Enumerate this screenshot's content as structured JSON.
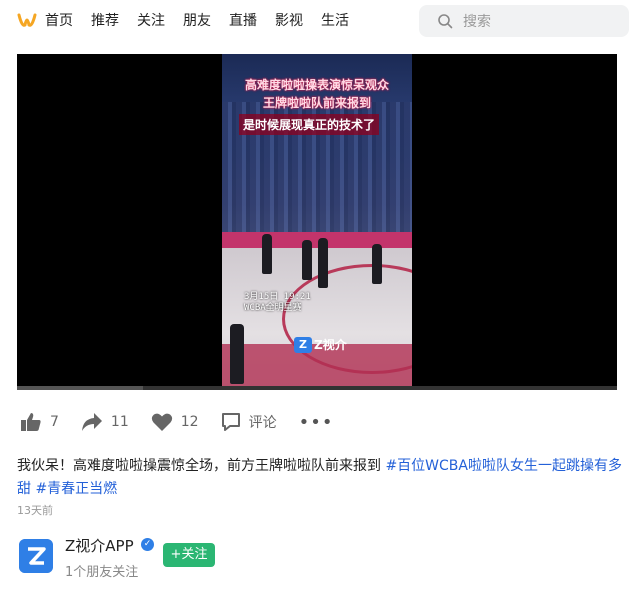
{
  "nav": {
    "items": [
      "首页",
      "推荐",
      "关注",
      "朋友",
      "直播",
      "影视",
      "生活"
    ],
    "search_placeholder": "搜索"
  },
  "video": {
    "overlay_title_1": "高难度啦啦操表演惊呆观众",
    "overlay_title_2": "王牌啦啦队前来报到",
    "overlay_caption": "是时候展现真正的技术了",
    "stamp_1": "3月15日 19:21",
    "stamp_2": "WCBA全明星赛",
    "watermark": "Z视介",
    "progress": 0.21
  },
  "actions": {
    "likes": "7",
    "shares": "11",
    "favorites": "12",
    "comment_label": "评论",
    "more": "•••"
  },
  "description": {
    "text": "我伙呆！高难度啦啦操震惊全场，前方王牌啦啦队前来报到 ",
    "tag1": "#百位WCBA啦啦队女生一起跳操有多甜",
    "tag2": "#青春正当燃",
    "time": "13天前"
  },
  "author": {
    "name": "Z视介APP",
    "follow_label": "+关注",
    "followers": "1个朋友关注"
  },
  "colors": {
    "accent": "#2461d8",
    "follow_green": "#2bb673",
    "logo_orange": "#f5a623"
  }
}
